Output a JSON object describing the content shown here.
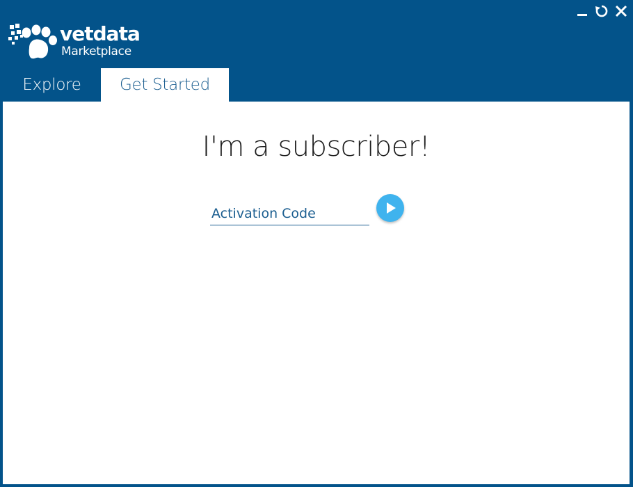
{
  "window": {
    "colors": {
      "frame": "#03538a",
      "accent": "#3fb3ee",
      "tab_text_active": "#1b5e90"
    },
    "controls": [
      {
        "name": "minimize",
        "icon": "minimize-icon"
      },
      {
        "name": "restore",
        "icon": "restore-icon"
      },
      {
        "name": "close",
        "icon": "close-icon"
      }
    ]
  },
  "logo": {
    "brand": "vetdata",
    "product": "Marketplace"
  },
  "tabs": [
    {
      "label": "Explore",
      "active": false
    },
    {
      "label": "Get Started",
      "active": true
    }
  ],
  "main": {
    "heading": "I'm a subscriber!",
    "activation": {
      "placeholder": "Activation Code",
      "value": ""
    },
    "submit_icon": "play-arrow-icon"
  }
}
